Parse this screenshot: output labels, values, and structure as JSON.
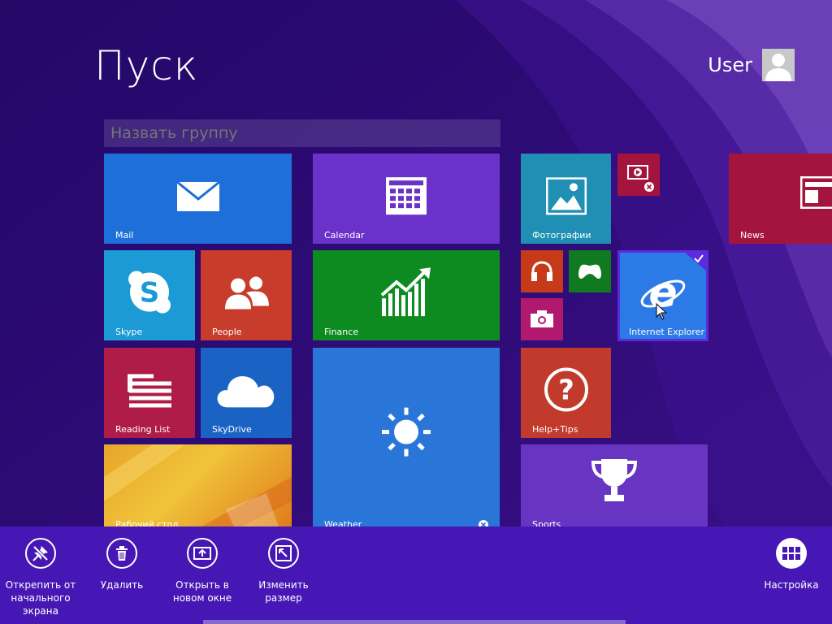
{
  "screen": {
    "title": "Пуск",
    "user": "User"
  },
  "group": {
    "placeholder": "Назвать группу"
  },
  "tiles": {
    "mail": "Mail",
    "calendar": "Calendar",
    "photos": "Фотографии",
    "news": "News",
    "skype": "Skype",
    "people": "People",
    "finance": "Finance",
    "ie": "Internet Explorer",
    "reading_list": "Reading List",
    "skydrive": "SkyDrive",
    "weather": "Weather",
    "help": "Help+Tips",
    "desktop": "Рабочий стол",
    "sports": "Sports"
  },
  "appbar": {
    "unpin": "Открепить от начального экрана",
    "uninstall": "Удалить",
    "open_new_window": "Открыть в новом окне",
    "resize": "Изменить размер",
    "customize": "Настройка"
  },
  "colors": {
    "background": "#2a0a72",
    "appbar": "#4617b4",
    "mail": "#1e6fd9",
    "calendar": "#6a32c8",
    "photos": "#1f8fb3",
    "news": "#a4143c",
    "skype": "#1b9ad6",
    "people": "#c83c2c",
    "finance": "#0e8b20",
    "ie": "#2c7ae6",
    "reading_list": "#b01c48",
    "skydrive": "#1a62c4",
    "weather": "#2a76d8",
    "help": "#c23a2c",
    "sports": "#6834c2"
  }
}
